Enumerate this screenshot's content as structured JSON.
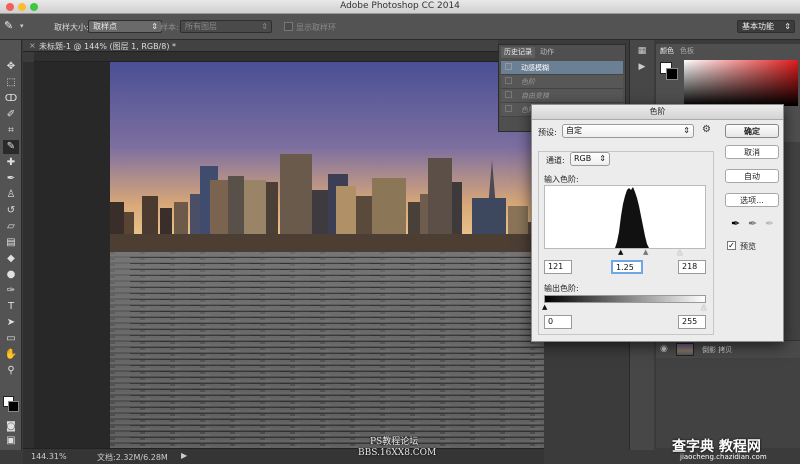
{
  "app": {
    "title": "Adobe Photoshop CC 2014",
    "workspace": "基本功能"
  },
  "options": {
    "sample_size_label": "取样大小:",
    "sample_size_value": "取样点",
    "sample_label": "样本:",
    "sample_value": "所有图层",
    "show_ring_label": "显示取样环"
  },
  "document": {
    "tab_title": "未标题-1 @ 144% (图层 1, RGB/8) *",
    "zoom": "144.31%",
    "doc_size": "文档:2.32M/6.28M"
  },
  "history_panel": {
    "tabs": [
      "历史记录",
      "动作"
    ],
    "items": [
      "动感模糊",
      "色阶",
      "自由变换",
      "色阶"
    ]
  },
  "color_panel": {
    "tabs": [
      "颜色",
      "色板"
    ]
  },
  "layers": {
    "layer_name": "倒影 拷贝"
  },
  "dialog": {
    "title": "色阶",
    "preset_label": "预设:",
    "preset_value": "自定",
    "channel_label": "通道:",
    "channel_value": "RGB",
    "input_label": "输入色阶:",
    "input_black": "121",
    "input_gamma": "1.25",
    "input_white": "218",
    "output_label": "输出色阶:",
    "output_black": "0",
    "output_white": "255",
    "buttons": {
      "ok": "确定",
      "cancel": "取消",
      "auto": "自动",
      "options": "选项..."
    },
    "preview_label": "预览"
  },
  "watermark": {
    "line1": "PS教程论坛",
    "line2": "BBS.16XX8.COM",
    "site": "查字典 教程网",
    "site_url": "jiaocheng.chazidian.com"
  }
}
